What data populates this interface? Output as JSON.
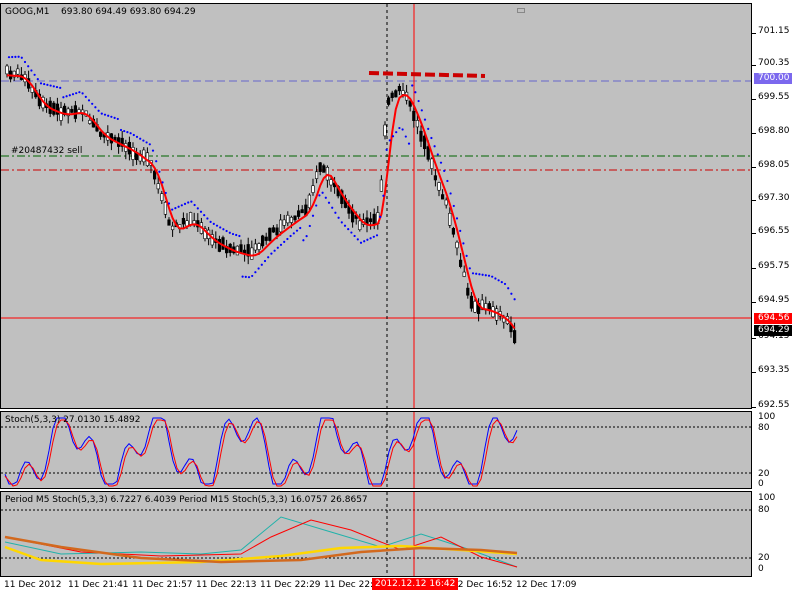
{
  "header": {
    "symbol": "GOOG,M1",
    "ohlc": "693.80 694.49 693.80 694.29"
  },
  "order_label": "#20487432 sell",
  "price_scale": {
    "ticks": [
      "701.15",
      "700.35",
      "699.55",
      "698.80",
      "698.05",
      "697.30",
      "696.55",
      "695.75",
      "694.95",
      "694.15",
      "693.35",
      "692.55"
    ],
    "level_tag": "700.00",
    "red_tag": "694.56",
    "current_tag": "694.29"
  },
  "stoch": {
    "label": "Stoch(5,3,3) 27.0130 15.4892",
    "ticks": [
      "100",
      "80",
      "20",
      "0"
    ]
  },
  "mtf": {
    "label": "Period M5 Stoch(5,3,3) 6.7227 6.4039  Period M15 Stoch(5,3,3) 16.0757 26.8657",
    "ticks": [
      "100",
      "80",
      "20",
      "0"
    ]
  },
  "time_axis": {
    "ticks": [
      "11 Dec 2012",
      "11 Dec 21:41",
      "11 Dec 21:57",
      "11 Dec 22:13",
      "11 Dec 22:29",
      "11 Dec 22:4",
      "12 Dec 16:52",
      "12 Dec 17:09"
    ],
    "highlight": "2012.12.12 16:42"
  },
  "colors": {
    "bg": "#c0c0c0",
    "candle": "#000000",
    "ma": "#ff0000",
    "sar": "#0000ff",
    "stoch_main": "#0000ff",
    "stoch_signal": "#ff0000",
    "level_blue": "#6666cc",
    "level_green": "#006400"
  },
  "chart_data": {
    "type": "candlestick",
    "close_sample": [
      700.2,
      699.9,
      699.6,
      699.4,
      699.3,
      699.1,
      698.6,
      698.4,
      698.3,
      697.6,
      697.0,
      696.6,
      696.2,
      696.0,
      696.3,
      696.8,
      697.1,
      697.4,
      698.0,
      697.6,
      697.1,
      696.9,
      697.4,
      698.8,
      699.2,
      698.0,
      697.4,
      696.5,
      695.4,
      694.9,
      694.29
    ],
    "ylim": [
      692.55,
      701.15
    ]
  }
}
